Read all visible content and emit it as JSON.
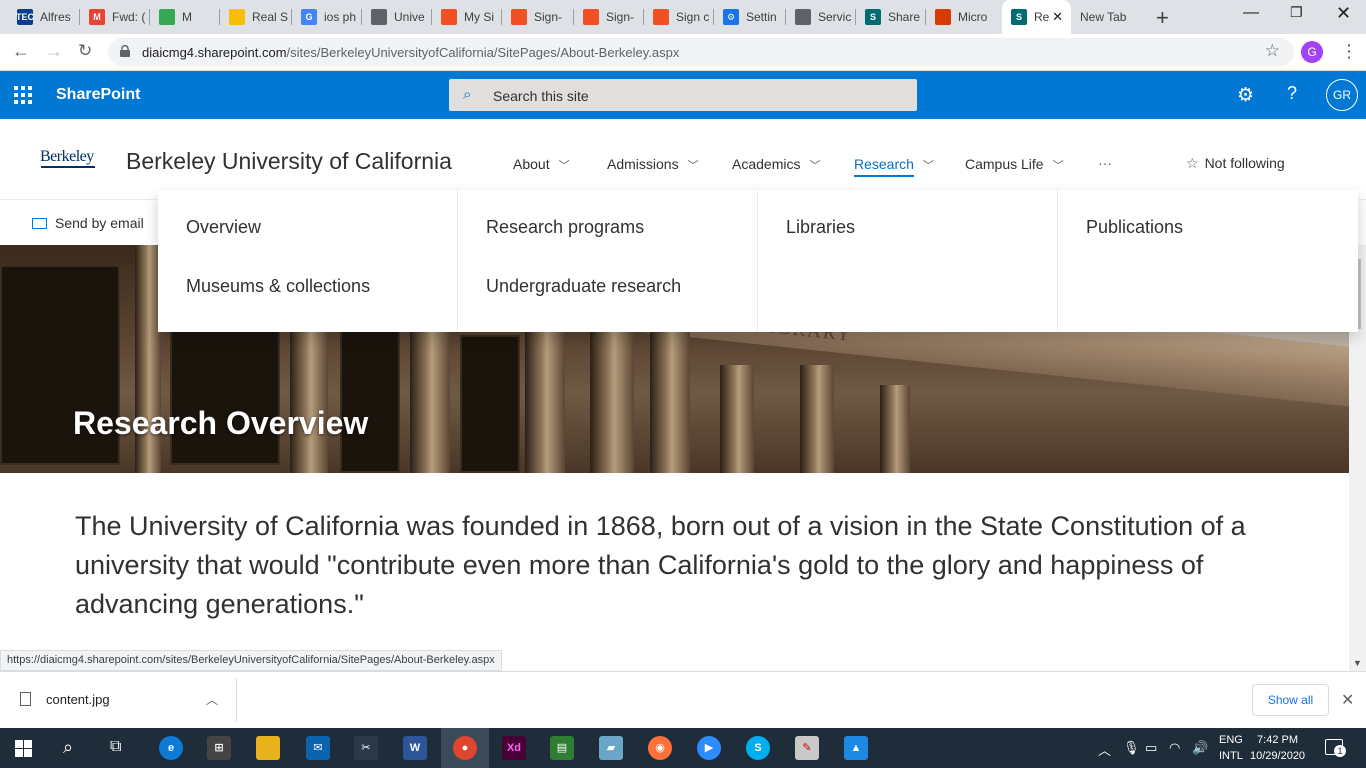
{
  "browser": {
    "tabs": [
      {
        "label": "Alfres",
        "fav_color": "#0b3d91",
        "fav_text": "TEC"
      },
      {
        "label": "Fwd: (",
        "fav_color": "#ea4335",
        "fav_text": "M"
      },
      {
        "label": "M",
        "fav_color": "#34a853",
        "fav_text": ""
      },
      {
        "label": "Real S",
        "fav_color": "#fbbc04",
        "fav_text": ""
      },
      {
        "label": "ios ph",
        "fav_color": "#4285f4",
        "fav_text": "G"
      },
      {
        "label": "Unive",
        "fav_color": "#5f6368",
        "fav_text": ""
      },
      {
        "label": "My Si",
        "fav_color": "#f25022",
        "fav_text": ""
      },
      {
        "label": "Sign-",
        "fav_color": "#f25022",
        "fav_text": ""
      },
      {
        "label": "Sign-",
        "fav_color": "#f25022",
        "fav_text": ""
      },
      {
        "label": "Sign c",
        "fav_color": "#f25022",
        "fav_text": ""
      },
      {
        "label": "Settin",
        "fav_color": "#1a73e8",
        "fav_text": "⚙"
      },
      {
        "label": "Servic",
        "fav_color": "#5f6368",
        "fav_text": ""
      },
      {
        "label": "Share",
        "fav_color": "#036c70",
        "fav_text": "S"
      },
      {
        "label": "Micro",
        "fav_color": "#d83b01",
        "fav_text": ""
      },
      {
        "label": "Re",
        "fav_color": "#036c70",
        "fav_text": "S"
      },
      {
        "label": "New Tab",
        "fav_color": "",
        "fav_text": ""
      }
    ],
    "url_host": "diaicmg4.sharepoint.com",
    "url_path": "/sites/BerkeleyUniversityofCalifornia/SitePages/About-Berkeley.aspx",
    "profile_initial": "G"
  },
  "suitebar": {
    "app_name": "SharePoint",
    "search_placeholder": "Search this site",
    "user_initials": "GR",
    "accent": "#0078d4"
  },
  "site": {
    "logo_text": "Berkeley",
    "title": "Berkeley University of California",
    "nav": [
      {
        "label": "About"
      },
      {
        "label": "Admissions"
      },
      {
        "label": "Academics"
      },
      {
        "label": "Research",
        "active": true
      },
      {
        "label": "Campus Life"
      }
    ],
    "more_label": "···",
    "follow_label": "Not following"
  },
  "commandbar": {
    "send_email": "Send by email"
  },
  "megamenu": {
    "columns": [
      [
        "Overview",
        "Museums & collections"
      ],
      [
        "Research programs",
        "Undergraduate research"
      ],
      [
        "Libraries"
      ],
      [
        "Publications"
      ]
    ]
  },
  "hero": {
    "title": "Research Overview",
    "inscription": "SITY LIBRARY"
  },
  "body": {
    "lead": "The University of California was founded in 1868, born out of a vision in the State Constitution of a university that would \"contribute even more than California's gold to the glory and happiness of advancing generations.\""
  },
  "status_url": "https://diaicmg4.sharepoint.com/sites/BerkeleyUniversityofCalifornia/SitePages/About-Berkeley.aspx",
  "downloads": {
    "file": "content.jpg",
    "show_all": "Show all"
  },
  "taskbar": {
    "lang_1": "ENG",
    "lang_2": "INTL",
    "time": "7:42 PM",
    "date": "10/29/2020",
    "notif_count": "1"
  }
}
